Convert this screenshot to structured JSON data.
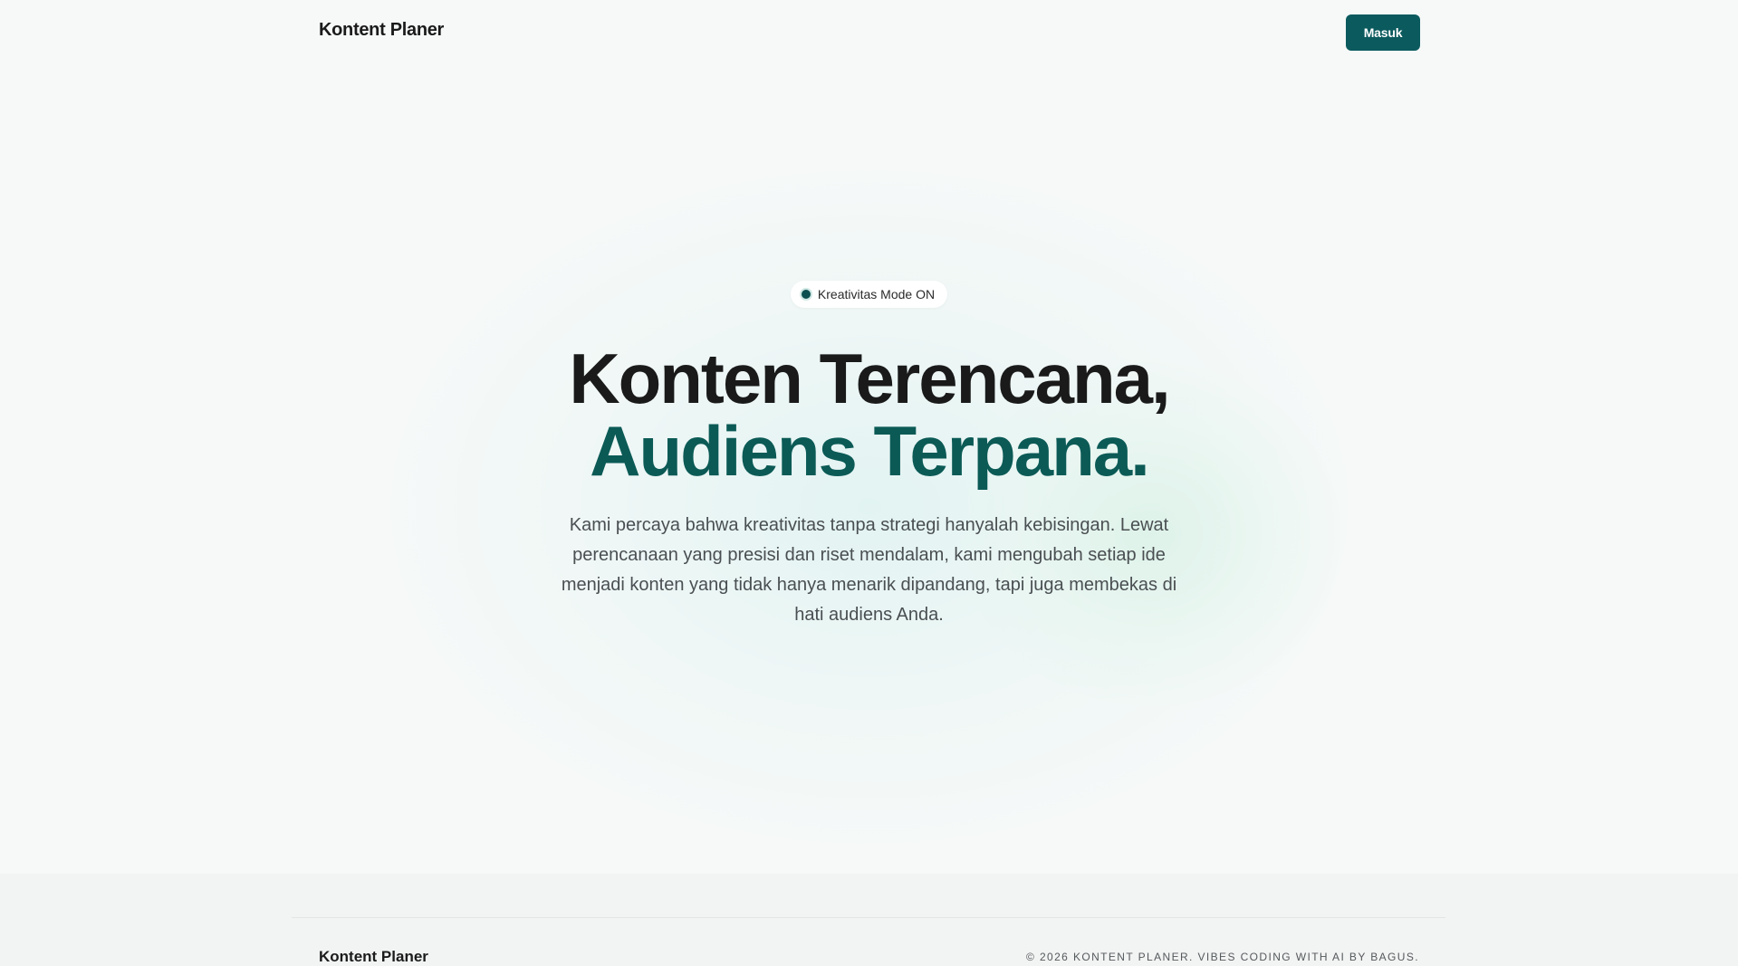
{
  "header": {
    "brand": "Kontent Planer",
    "login_label": "Masuk"
  },
  "hero": {
    "badge": "Kreativitas Mode ON",
    "title_line1": "Konten Terencana,",
    "title_line2": "Audiens Terpana.",
    "description": "Kami percaya bahwa kreativitas tanpa strategi hanyalah kebisingan. Lewat perencanaan yang presisi dan riset mendalam, kami mengubah setiap ide menjadi konten yang tidak hanya menarik dipandang, tapi juga membekas di hati audiens Anda."
  },
  "footer": {
    "brand": "Kontent Planer",
    "copyright": "© 2026 KONTENT PLANER. VIBES CODING WITH AI BY BAGUS."
  },
  "colors": {
    "accent": "#0b5a5e",
    "accent_text": "#0b5a56",
    "background": "#f6f9f8",
    "footer_background": "#f2f3f3"
  }
}
